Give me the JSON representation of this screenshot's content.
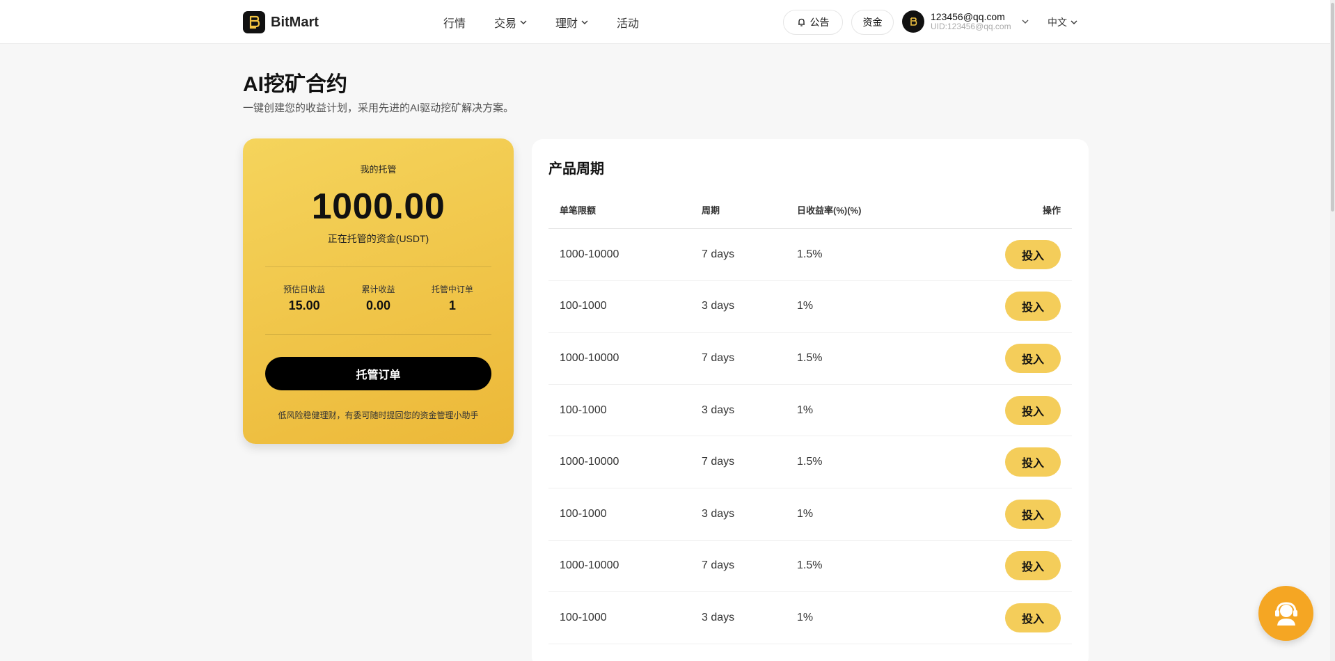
{
  "header": {
    "brand": "BitMart",
    "nav": [
      {
        "label": "行情",
        "has_dropdown": false
      },
      {
        "label": "交易",
        "has_dropdown": true
      },
      {
        "label": "理财",
        "has_dropdown": true
      },
      {
        "label": "活动",
        "has_dropdown": false
      }
    ],
    "announcement_label": "公告",
    "funds_label": "资金",
    "user_email": "123456@qq.com",
    "user_uid": "UID:123456@qq.com",
    "language": "中文"
  },
  "page": {
    "title": "AI挖矿合约",
    "subtitle": "一键创建您的收益计划，采用先进的AI驱动挖矿解决方案。"
  },
  "custody_card": {
    "label": "我的托管",
    "amount": "1000.00",
    "unit_label": "正在托管的资金(USDT)",
    "stats": [
      {
        "label": "预估日收益",
        "value": "15.00"
      },
      {
        "label": "累计收益",
        "value": "0.00"
      },
      {
        "label": "托管中订单",
        "value": "1"
      }
    ],
    "order_button": "托管订单",
    "note": "低风险稳健理财，有委可随时提回您的资金管理小助手"
  },
  "products": {
    "title": "产品周期",
    "columns": [
      "单笔限额",
      "周期",
      "日收益率(%)(%)",
      "操作"
    ],
    "invest_label": "投入",
    "rows": [
      {
        "limit": "1000-10000",
        "period": "7 days",
        "rate": "1.5%"
      },
      {
        "limit": "100-1000",
        "period": "3 days",
        "rate": "1%"
      },
      {
        "limit": "1000-10000",
        "period": "7 days",
        "rate": "1.5%"
      },
      {
        "limit": "100-1000",
        "period": "3 days",
        "rate": "1%"
      },
      {
        "limit": "1000-10000",
        "period": "7 days",
        "rate": "1.5%"
      },
      {
        "limit": "100-1000",
        "period": "3 days",
        "rate": "1%"
      },
      {
        "limit": "1000-10000",
        "period": "7 days",
        "rate": "1.5%"
      },
      {
        "limit": "100-1000",
        "period": "3 days",
        "rate": "1%"
      }
    ]
  },
  "colors": {
    "accent_yellow": "#f4cd5a",
    "support_orange": "#f5a623",
    "dark": "#000000"
  },
  "icons": [
    "logo-icon",
    "bell-icon",
    "chevron-down-icon",
    "bitmart-avatar-icon",
    "customer-support-icon"
  ]
}
